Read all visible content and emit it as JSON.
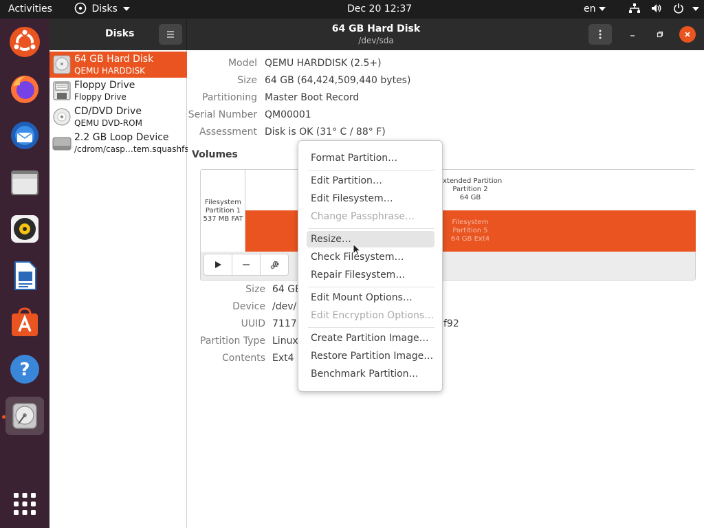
{
  "topbar": {
    "activities": "Activities",
    "app_menu": "Disks",
    "clock": "Dec 20  12:37",
    "language": "enₕ",
    "language_text": "en"
  },
  "dock": {
    "items": [
      "ubuntu-software-launcher",
      "firefox",
      "thunderbird",
      "files",
      "rhythmbox",
      "libreoffice-writer",
      "ubuntu-software",
      "help",
      "disks",
      "show-applications"
    ]
  },
  "header": {
    "sidebar_title": "Disks",
    "title": "64 GB Hard Disk",
    "subtitle": "/dev/sda"
  },
  "drives": [
    {
      "name": "64 GB Hard Disk",
      "sub": "QEMU HARDDISK",
      "icon": "hard-disk-icon"
    },
    {
      "name": "Floppy Drive",
      "sub": "Floppy Drive",
      "icon": "floppy-icon"
    },
    {
      "name": "CD/DVD Drive",
      "sub": "QEMU DVD-ROM",
      "icon": "optical-disc-icon"
    },
    {
      "name": "2.2 GB Loop Device",
      "sub": "/cdrom/casp…tem.squashfs",
      "icon": "loop-device-icon"
    }
  ],
  "disk_info": {
    "model_label": "Model",
    "model": "QEMU HARDDISK (2.5+)",
    "size_label": "Size",
    "size": "64 GB (64,424,509,440 bytes)",
    "partitioning_label": "Partitioning",
    "partitioning": "Master Boot Record",
    "serial_label": "Serial Number",
    "serial": "QM00001",
    "assessment_label": "Assessment",
    "assessment": "Disk is OK (31° C / 88° F)"
  },
  "volumes": {
    "heading": "Volumes",
    "part1": {
      "line1": "Filesystem",
      "line2": "Partition 1",
      "line3": "537 MB FAT"
    },
    "extended": {
      "line1": "Extended Partition",
      "line2": "Partition 2",
      "line3": "64 GB"
    },
    "part5": {
      "line1": "Filesystem",
      "line2": "Partition 5",
      "line3": "64 GB Ext4"
    }
  },
  "partition_info": {
    "size_label": "Size",
    "size": "64 GB",
    "device_label": "Device",
    "device": "/dev/",
    "uuid_label": "UUID",
    "uuid": "71171",
    "uuid_tail": "f92",
    "type_label": "Partition Type",
    "type": "Linux",
    "contents_label": "Contents",
    "contents": "Ext4 ("
  },
  "menu": {
    "items": [
      {
        "label": "Format Partition…",
        "enabled": true
      },
      {
        "label": "Edit Partition…",
        "enabled": true
      },
      {
        "label": "Edit Filesystem…",
        "enabled": true
      },
      {
        "label": "Change Passphrase…",
        "enabled": false
      },
      {
        "label": "Resize…",
        "enabled": true,
        "hover": true
      },
      {
        "label": "Check Filesystem…",
        "enabled": true
      },
      {
        "label": "Repair Filesystem…",
        "enabled": true
      },
      {
        "label": "Edit Mount Options…",
        "enabled": true
      },
      {
        "label": "Edit Encryption Options…",
        "enabled": false
      },
      {
        "label": "Create Partition Image…",
        "enabled": true
      },
      {
        "label": "Restore Partition Image…",
        "enabled": true
      },
      {
        "label": "Benchmark Partition…",
        "enabled": true
      }
    ]
  },
  "colors": {
    "accent": "#e95420",
    "topbar": "#1d1d1d",
    "dock": "#3b2232",
    "headerbar": "#2c2c2c"
  }
}
